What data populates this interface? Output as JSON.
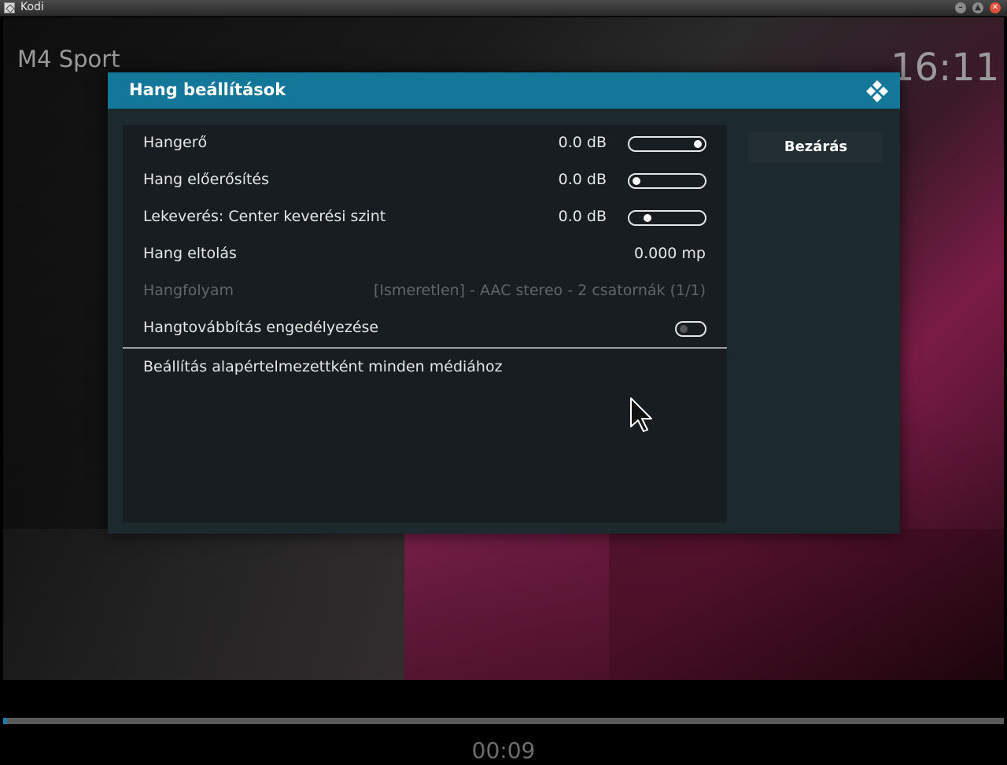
{
  "window": {
    "title": "Kodi",
    "icons": [
      "kodi-app-icon",
      "minimize-icon",
      "maximize-icon",
      "close-icon"
    ]
  },
  "osd": {
    "channel": "M4 Sport",
    "clock": "16:11",
    "elapsed": "00:09",
    "progress_fraction": 0.004
  },
  "dialog": {
    "title": "Hang beállítások",
    "close_label": "Bezárás",
    "rows": [
      {
        "label": "Hangerő",
        "value": "0.0 dB",
        "control": "slider",
        "level": 1.0
      },
      {
        "label": "Hang előerősítés",
        "value": "0.0 dB",
        "control": "slider",
        "level": 0.0
      },
      {
        "label": "Lekeverés: Center keverési szint",
        "value": "0.0 dB",
        "control": "slider",
        "level": 0.18
      },
      {
        "label": "Hang eltolás",
        "value": "0.000 mp",
        "control": "none"
      },
      {
        "label": "Hangfolyam",
        "value": "[Ismeretlen] - AAC stereo - 2 csatornák (1/1)",
        "control": "none",
        "disabled": true
      },
      {
        "label": "Hangtovábbítás engedélyezése",
        "control": "toggle",
        "on": false
      }
    ],
    "default_label": "Beállítás alapértelmezettként minden médiához"
  },
  "colors": {
    "accent": "#13779a",
    "dialog_bg": "#1c2a2e",
    "panel_bg": "#171d20"
  }
}
